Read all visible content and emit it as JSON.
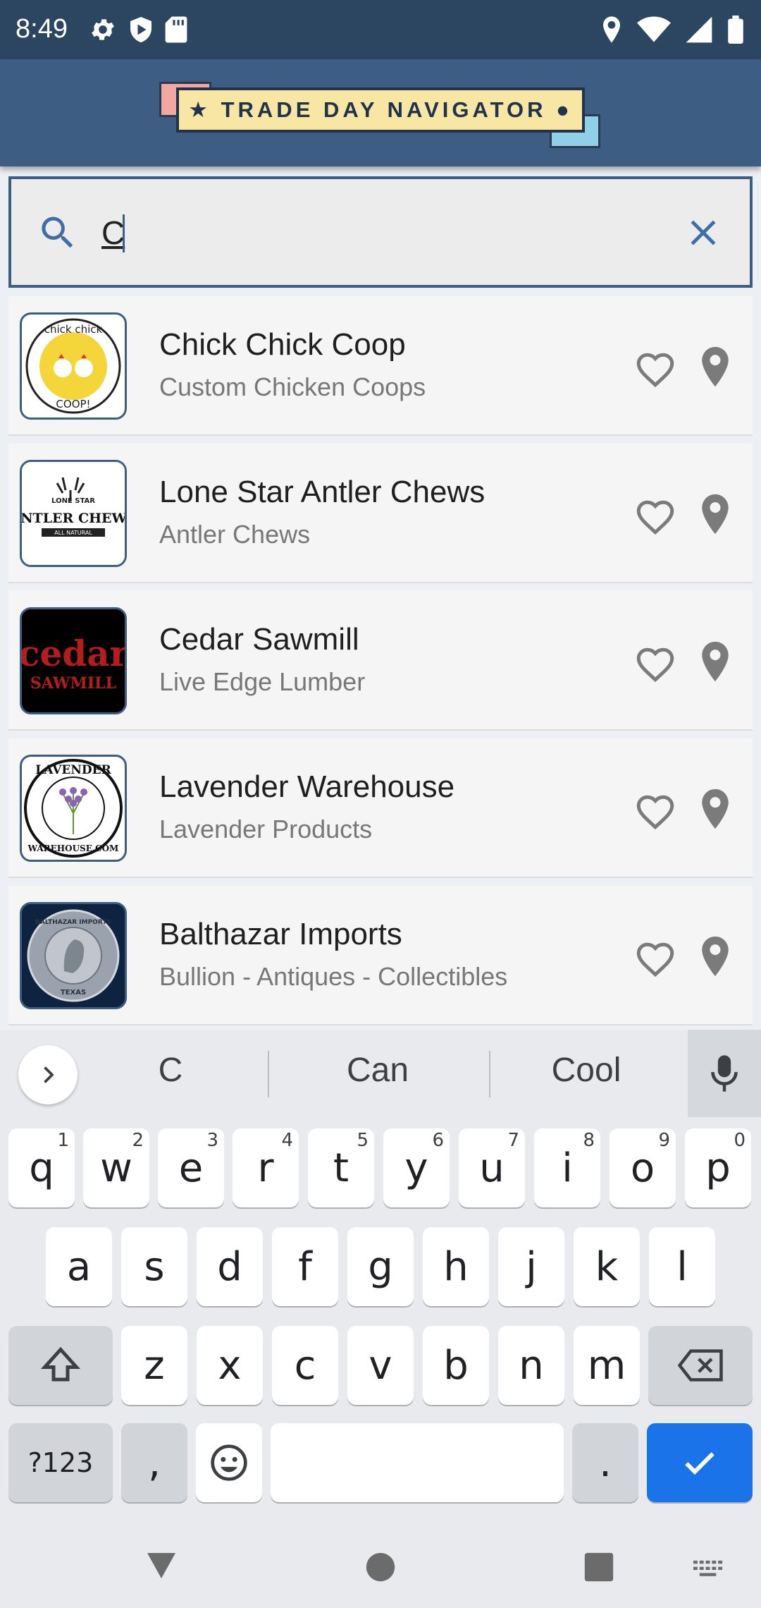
{
  "status_bar": {
    "time": "8:49"
  },
  "header": {
    "logo_text": "★ TRADE DAY NAVIGATOR ●"
  },
  "search": {
    "value": "C"
  },
  "vendors": [
    {
      "name": "Chick Chick Coop",
      "category": "Custom Chicken Coops",
      "logo_top": "chick chick",
      "logo_bottom": "COOP!"
    },
    {
      "name": "Lone Star Antler Chews",
      "category": "Antler Chews",
      "logo_top": "LONE STAR",
      "logo_main": "ANTLER CHEWS",
      "logo_bottom": "ALL NATURAL"
    },
    {
      "name": "Cedar Sawmill",
      "category": "Live Edge Lumber",
      "logo_main": "cedar",
      "logo_sub": "SAWMILL"
    },
    {
      "name": "Lavender Warehouse",
      "category": "Lavender Products",
      "logo_top": "LAVENDER",
      "logo_bottom": "WAREHOUSE.COM"
    },
    {
      "name": "Balthazar Imports",
      "category": "Bullion - Antiques - Collectibles",
      "logo_top": "BALTHAZAR IMPORTS",
      "logo_bottom": "TEXAS"
    }
  ],
  "keyboard": {
    "suggestions": [
      "C",
      "Can",
      "Cool"
    ],
    "row1": [
      "q",
      "w",
      "e",
      "r",
      "t",
      "y",
      "u",
      "i",
      "o",
      "p"
    ],
    "row1_hints": [
      "1",
      "2",
      "3",
      "4",
      "5",
      "6",
      "7",
      "8",
      "9",
      "0"
    ],
    "row2": [
      "a",
      "s",
      "d",
      "f",
      "g",
      "h",
      "j",
      "k",
      "l"
    ],
    "row3": [
      "z",
      "x",
      "c",
      "v",
      "b",
      "n",
      "m"
    ],
    "symbols_key": "?123",
    "comma_key": ",",
    "period_key": "."
  },
  "colors": {
    "header": "#3d5e82",
    "status_bar": "#2c4561",
    "accent": "#1a73e8"
  }
}
